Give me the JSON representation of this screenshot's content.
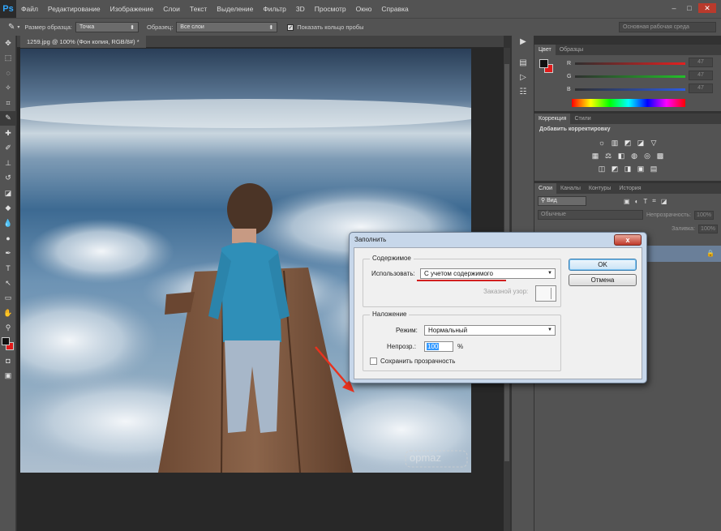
{
  "app": {
    "logo": "Ps",
    "menu": [
      "Файл",
      "Редактирование",
      "Изображение",
      "Слои",
      "Текст",
      "Выделение",
      "Фильтр",
      "3D",
      "Просмотр",
      "Окно",
      "Справка"
    ],
    "window_buttons": [
      "–",
      "□",
      "✕"
    ]
  },
  "options": {
    "sample_size_label": "Размер образца:",
    "sample_size_value": "Точка",
    "sample_label": "Образец:",
    "sample_value": "Все слои",
    "show_ring_label": "Показать кольцо пробы",
    "workspace": "Основная рабочая среда"
  },
  "document": {
    "tab_title": "1259.jpg @ 100% (Фон копия, RGB/8#) *",
    "watermark": "opmaz"
  },
  "color_panel": {
    "tabs": [
      "Цвет",
      "Образцы"
    ],
    "channels": [
      {
        "label": "R",
        "value": "47"
      },
      {
        "label": "G",
        "value": "47"
      },
      {
        "label": "B",
        "value": "47"
      }
    ]
  },
  "adjustments_panel": {
    "tabs": [
      "Коррекция",
      "Стили"
    ],
    "title": "Добавить корректировку"
  },
  "layers_panel": {
    "tabs": [
      "Слои",
      "Каналы",
      "Контуры",
      "История"
    ],
    "kind_filter": "Вид",
    "blend_mode": "Обычные",
    "opacity_label": "Непрозрачность:",
    "opacity_value": "100%",
    "fill_label": "Заливка:",
    "fill_value": "100%"
  },
  "fill_dialog": {
    "title": "Заполнить",
    "close": "x",
    "contents_group": "Содержимое",
    "use_label": "Использовать:",
    "use_value": "С учетом содержимого",
    "custom_pattern_label": "Заказной узор:",
    "blending_group": "Наложение",
    "mode_label": "Режим:",
    "mode_value": "Нормальный",
    "opacity_label": "Непрозр.:",
    "opacity_value": "100",
    "opacity_unit": "%",
    "preserve_label": "Сохранить прозрачность",
    "ok_label": "OK",
    "cancel_label": "Отмена"
  },
  "colors": {
    "accent_red": "#e01a1a",
    "dialog_frame": "#c7d7ea"
  }
}
